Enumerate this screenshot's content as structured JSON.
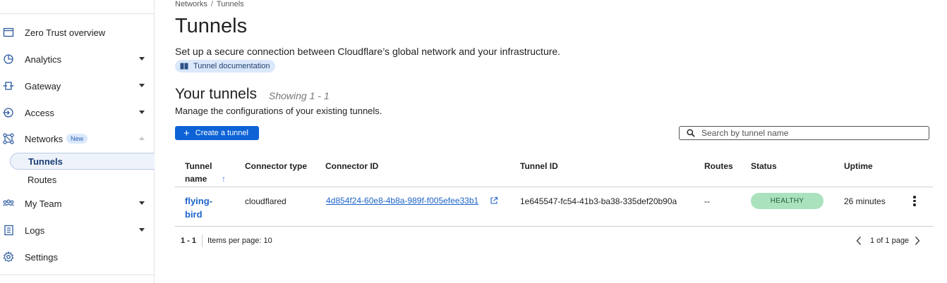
{
  "sidebar": {
    "items": [
      {
        "label": "Zero Trust overview",
        "icon": "browser-window-icon"
      },
      {
        "label": "Analytics",
        "icon": "clock-pie-icon"
      },
      {
        "label": "Gateway",
        "icon": "gateway-icon"
      },
      {
        "label": "Access",
        "icon": "sign-in-icon"
      },
      {
        "label": "Networks",
        "icon": "network-icon",
        "badge": "New"
      },
      {
        "label": "My Team",
        "icon": "team-icon"
      },
      {
        "label": "Logs",
        "icon": "logs-icon"
      },
      {
        "label": "Settings",
        "icon": "gear-icon"
      }
    ],
    "sub_items": [
      {
        "label": "Tunnels",
        "active": true
      },
      {
        "label": "Routes",
        "active": false
      }
    ]
  },
  "breadcrumb": {
    "parent": "Networks",
    "separator": "/",
    "current": "Tunnels"
  },
  "page": {
    "title": "Tunnels",
    "description": "Set up a secure connection between Cloudflare’s global network and your infrastructure.",
    "doc_link": "Tunnel documentation"
  },
  "section": {
    "title": "Your tunnels",
    "showing": "Showing 1 - 1",
    "description": "Manage the configurations of your existing tunnels."
  },
  "toolbar": {
    "create_label": "Create a tunnel",
    "search_placeholder": "Search by tunnel name"
  },
  "table": {
    "headers": {
      "tunnel_name": "Tunnel name",
      "connector_type": "Connector type",
      "connector_id": "Connector ID",
      "tunnel_id": "Tunnel ID",
      "routes": "Routes",
      "status": "Status",
      "uptime": "Uptime"
    },
    "rows": [
      {
        "tunnel_name": "flying-bird",
        "connector_type": "cloudflared",
        "connector_id": "4d854f24-60e8-4b8a-989f-f005efee33b1",
        "tunnel_id": "1e645547-fc54-41b3-ba38-335def20b90a",
        "routes": "--",
        "status": "HEALTHY",
        "uptime": "26 minutes"
      }
    ]
  },
  "pagination": {
    "range": "1 - 1",
    "items_per_page": "Items per page: 10",
    "page_info": "1 of 1 page"
  },
  "colors": {
    "accent": "#0d63d6",
    "link": "#1d63c9",
    "healthy": "#a9e2bd",
    "badge_bg": "#dbe8fb"
  }
}
